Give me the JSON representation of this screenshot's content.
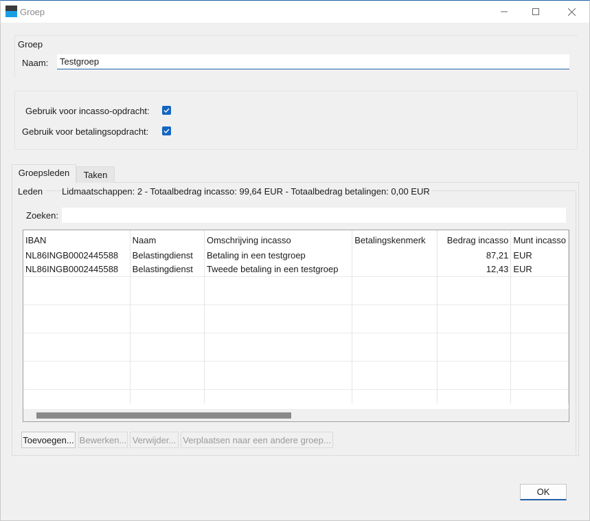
{
  "window": {
    "title": "Groep",
    "controls": {
      "minimize_icon": "minimize-icon",
      "maximize_icon": "maximize-icon",
      "close_icon": "close-icon"
    }
  },
  "group": {
    "heading": "Groep",
    "name_label": "Naam:",
    "name_value": "Testgroep"
  },
  "usage": {
    "incasso_label": "Gebruik voor incasso-opdracht:",
    "incasso_checked": true,
    "betaling_label": "Gebruik voor betalingsopdracht:",
    "betaling_checked": true
  },
  "tabs": [
    {
      "label": "Groepsleden",
      "active": true
    },
    {
      "label": "Taken",
      "active": false
    }
  ],
  "members": {
    "heading": "Leden",
    "summary": "Lidmaatschappen: 2 - Totaalbedrag incasso: 99,64 EUR - Totaalbedrag betalingen: 0,00 EUR",
    "search_label": "Zoeken:",
    "search_value": "",
    "columns": [
      "IBAN",
      "Naam",
      "Omschrijving incasso",
      "Betalingskenmerk",
      "Bedrag incasso",
      "Munt incasso"
    ],
    "rows": [
      [
        "NL86INGB0002445588",
        "Belastingdienst",
        "Betaling in een testgroep",
        "",
        "87,21",
        "EUR"
      ],
      [
        "NL86INGB0002445588",
        "Belastingdienst",
        "Tweede betaling in een testgroep",
        "",
        "12,43",
        "EUR"
      ]
    ]
  },
  "actions": {
    "add": "Toevoegen...",
    "edit": "Bewerken...",
    "delete": "Verwijder...",
    "move": "Verplaatsen naar een andere groep..."
  },
  "footer": {
    "ok": "OK"
  },
  "colors": {
    "accent": "#1565c0",
    "window_bg": "#f0f0f0"
  }
}
